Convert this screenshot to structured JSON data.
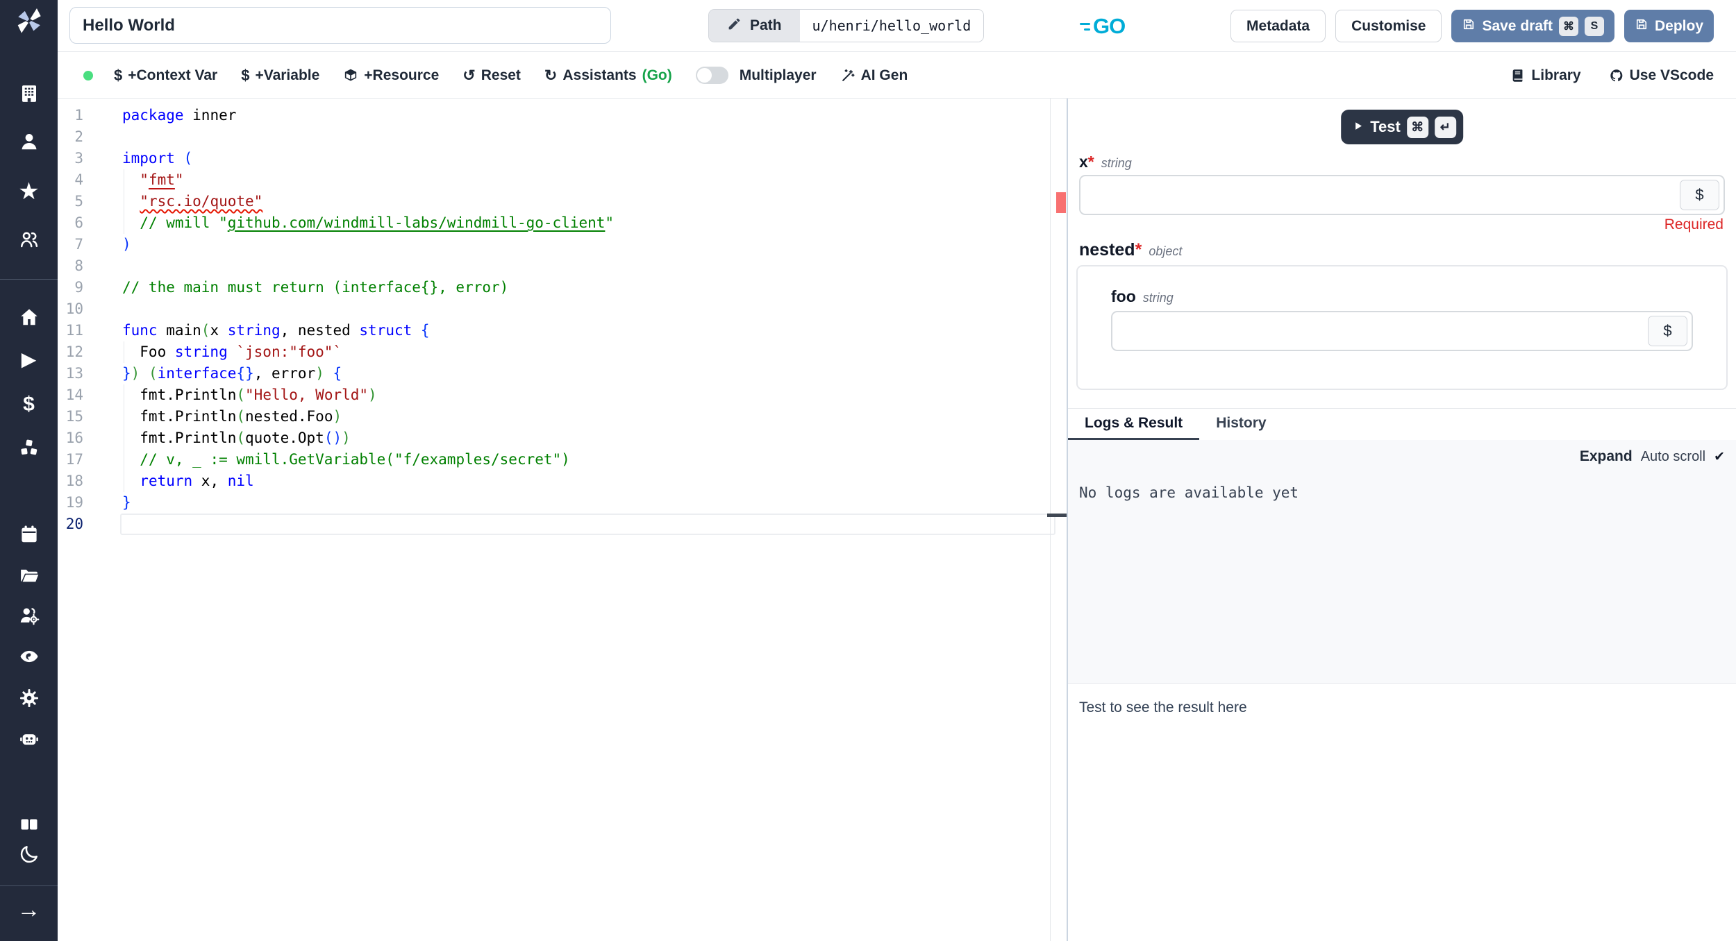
{
  "colors": {
    "sidebar_bg": "#232a3b",
    "primary_button": "#5f7da8",
    "test_button": "#2c3545",
    "go_cyan": "#00acd7",
    "green_dot": "#4ade80",
    "assistant_green": "#16a34a",
    "error_red": "#dc2626",
    "marker_red": "#f87171",
    "keyword_blue": "#0000ff",
    "string_red": "#a31515",
    "comment_green": "#008000"
  },
  "header": {
    "title_value": "Hello World",
    "path_label": "Path",
    "path_value": "u/henri/hello_world",
    "lang_badge": "GO",
    "metadata": "Metadata",
    "customise": "Customise",
    "save_draft": "Save draft",
    "save_kbd": [
      "⌘",
      "S"
    ],
    "deploy": "Deploy"
  },
  "toolbar": {
    "items_left": [
      {
        "icon": "dollar-sign",
        "label": "+Context Var",
        "name": "add-context-var"
      },
      {
        "icon": "dollar-sign",
        "label": "+Variable",
        "name": "add-variable"
      },
      {
        "icon": "box",
        "label": "+Resource",
        "name": "add-resource"
      },
      {
        "icon": "reset",
        "label": "Reset",
        "name": "reset"
      },
      {
        "icon": "refresh",
        "label": "Assistants",
        "suffix": "(Go)",
        "name": "assistants"
      }
    ],
    "multiplayer_label": "Multiplayer",
    "items_after_toggle": [
      {
        "icon": "wand",
        "label": "AI Gen",
        "name": "ai-gen"
      }
    ],
    "items_right": [
      {
        "icon": "book",
        "label": "Library",
        "name": "library"
      },
      {
        "icon": "github",
        "label": "Use VScode",
        "name": "use-vscode"
      }
    ]
  },
  "sidebar": {
    "items": [
      {
        "icon": "building",
        "name": "workspace"
      },
      {
        "icon": "user",
        "name": "user"
      },
      {
        "icon": "star",
        "name": "favorites"
      },
      {
        "icon": "users",
        "name": "collaborators"
      },
      {
        "icon": "home",
        "name": "home"
      },
      {
        "icon": "play",
        "name": "runs"
      },
      {
        "icon": "dollar",
        "name": "variables"
      },
      {
        "icon": "cubes",
        "name": "resources"
      },
      {
        "icon": "calendar",
        "name": "schedules"
      },
      {
        "icon": "folder",
        "name": "folders"
      },
      {
        "icon": "users-gear",
        "name": "groups"
      },
      {
        "icon": "eye",
        "name": "audit-logs"
      },
      {
        "icon": "gear",
        "name": "settings"
      },
      {
        "icon": "robot",
        "name": "workers"
      },
      {
        "icon": "book-open",
        "name": "docs"
      },
      {
        "icon": "moon",
        "name": "dark-mode"
      },
      {
        "icon": "arrow-right",
        "name": "expand-sidebar"
      }
    ]
  },
  "editor": {
    "lines": [
      {
        "n": 1,
        "guide": false,
        "active": false,
        "tokens": [
          [
            "kw",
            "package"
          ],
          [
            "pl",
            " inner"
          ]
        ]
      },
      {
        "n": 2,
        "guide": false,
        "active": false,
        "tokens": []
      },
      {
        "n": 3,
        "guide": false,
        "active": false,
        "tokens": [
          [
            "kw",
            "import"
          ],
          [
            "pl",
            " "
          ],
          [
            "b1",
            "("
          ]
        ]
      },
      {
        "n": 4,
        "guide": true,
        "active": false,
        "tokens": [
          [
            "pl",
            "  "
          ],
          [
            "str",
            "\""
          ],
          [
            "stru",
            "fmt"
          ],
          [
            "str",
            "\""
          ]
        ]
      },
      {
        "n": 5,
        "guide": true,
        "active": false,
        "tokens": [
          [
            "pl",
            "  "
          ],
          [
            "sq",
            "\"rsc.io/quote\""
          ]
        ]
      },
      {
        "n": 6,
        "guide": true,
        "active": false,
        "tokens": [
          [
            "pl",
            "  "
          ],
          [
            "com",
            "// wmill \""
          ],
          [
            "link",
            "github.com/windmill-labs/windmill-go-client"
          ],
          [
            "com",
            "\""
          ]
        ]
      },
      {
        "n": 7,
        "guide": false,
        "active": false,
        "tokens": [
          [
            "b1",
            ")"
          ]
        ]
      },
      {
        "n": 8,
        "guide": false,
        "active": false,
        "tokens": []
      },
      {
        "n": 9,
        "guide": false,
        "active": false,
        "tokens": [
          [
            "com",
            "// the main must return (interface{}, error)"
          ]
        ]
      },
      {
        "n": 10,
        "guide": false,
        "active": false,
        "tokens": []
      },
      {
        "n": 11,
        "guide": false,
        "active": false,
        "tokens": [
          [
            "kw",
            "func"
          ],
          [
            "pl",
            " main"
          ],
          [
            "b2",
            "("
          ],
          [
            "pl",
            "x "
          ],
          [
            "kw",
            "string"
          ],
          [
            "pl",
            ", nested "
          ],
          [
            "kw",
            "struct"
          ],
          [
            "pl",
            " "
          ],
          [
            "b1",
            "{"
          ]
        ]
      },
      {
        "n": 12,
        "guide": true,
        "active": false,
        "tokens": [
          [
            "pl",
            "  Foo "
          ],
          [
            "kw",
            "string"
          ],
          [
            "pl",
            " "
          ],
          [
            "str",
            "`json:\"foo\"`"
          ]
        ]
      },
      {
        "n": 13,
        "guide": false,
        "active": false,
        "tokens": [
          [
            "b1",
            "}"
          ],
          [
            "b2",
            ")"
          ],
          [
            "pl",
            " "
          ],
          [
            "b2",
            "("
          ],
          [
            "kw",
            "interface"
          ],
          [
            "b1",
            "{}"
          ],
          [
            "pl",
            ", error"
          ],
          [
            "b2",
            ")"
          ],
          [
            "pl",
            " "
          ],
          [
            "b1",
            "{"
          ]
        ]
      },
      {
        "n": 14,
        "guide": true,
        "active": false,
        "tokens": [
          [
            "pl",
            "  fmt.Println"
          ],
          [
            "b2",
            "("
          ],
          [
            "str",
            "\"Hello, World\""
          ],
          [
            "b2",
            ")"
          ]
        ]
      },
      {
        "n": 15,
        "guide": true,
        "active": false,
        "tokens": [
          [
            "pl",
            "  fmt.Println"
          ],
          [
            "b2",
            "("
          ],
          [
            "pl",
            "nested.Foo"
          ],
          [
            "b2",
            ")"
          ]
        ]
      },
      {
        "n": 16,
        "guide": true,
        "active": false,
        "tokens": [
          [
            "pl",
            "  fmt.Println"
          ],
          [
            "b2",
            "("
          ],
          [
            "pl",
            "quote.Opt"
          ],
          [
            "b1",
            "()"
          ],
          [
            "b2",
            ")"
          ]
        ]
      },
      {
        "n": 17,
        "guide": true,
        "active": false,
        "tokens": [
          [
            "pl",
            "  "
          ],
          [
            "com",
            "// v, _ := wmill.GetVariable(\"f/examples/secret\")"
          ]
        ]
      },
      {
        "n": 18,
        "guide": true,
        "active": false,
        "tokens": [
          [
            "pl",
            "  "
          ],
          [
            "kw",
            "return"
          ],
          [
            "pl",
            " x, "
          ],
          [
            "kw",
            "nil"
          ]
        ]
      },
      {
        "n": 19,
        "guide": false,
        "active": false,
        "tokens": [
          [
            "b1",
            "}"
          ]
        ]
      },
      {
        "n": 20,
        "guide": false,
        "active": true,
        "tokens": []
      }
    ]
  },
  "panel": {
    "test": {
      "label": "Test",
      "kbd": [
        "⌘",
        "↵"
      ]
    },
    "args": {
      "x_name": "x",
      "x_req": "*",
      "x_type": "string",
      "required_msg": "Required",
      "nested_name": "nested",
      "nested_req": "*",
      "nested_type": "object",
      "foo_name": "foo",
      "foo_type": "string",
      "dollar": "$"
    },
    "tabs": {
      "logs": "Logs & Result",
      "history": "History"
    },
    "logs": {
      "expand": "Expand",
      "autoscroll": "Auto scroll",
      "check": "✔",
      "empty": "No logs are available yet"
    },
    "result_placeholder": "Test to see the result here"
  }
}
